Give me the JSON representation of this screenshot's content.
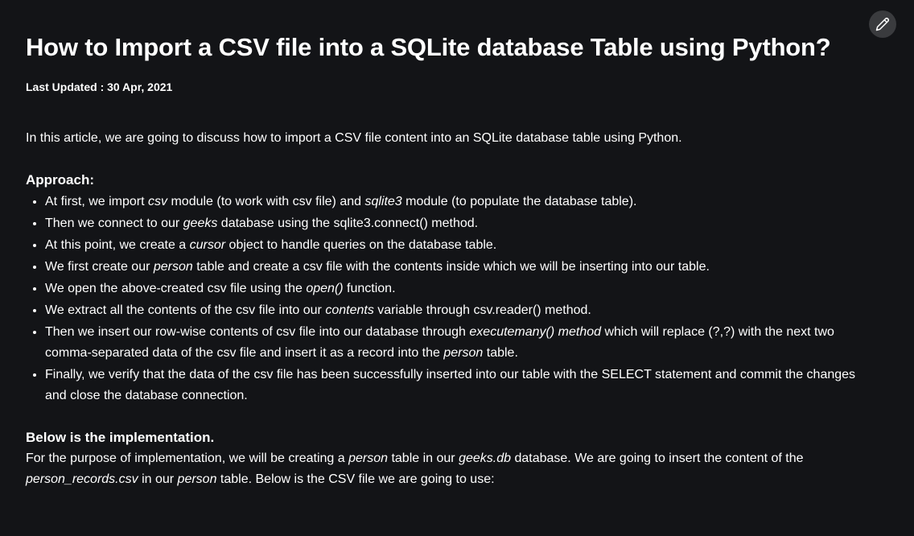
{
  "header": {
    "title": "How to Import a CSV file into a SQLite database Table using Python?",
    "last_updated": "Last Updated : 30 Apr, 2021",
    "edit_icon": "pencil-icon"
  },
  "article": {
    "intro": "In this article, we are going to discuss how to import a CSV file content into an SQLite database table using Python.",
    "approach_heading": "Approach:",
    "steps": [
      {
        "p1": "At first, we import ",
        "i1": "csv",
        "p2": " module (to work with csv file) and ",
        "i2": "sqlite3",
        "p3": " module (to populate the database table).",
        "i3": "",
        "p4": ""
      },
      {
        "p1": "Then we connect to our ",
        "i1": "geeks",
        "p2": " database using the sqlite3.connect() method.",
        "i2": "",
        "p3": "",
        "i3": "",
        "p4": ""
      },
      {
        "p1": "At this point, we create a ",
        "i1": "cursor",
        "p2": " object to handle queries on the database table.",
        "i2": "",
        "p3": "",
        "i3": "",
        "p4": ""
      },
      {
        "p1": "We first create our ",
        "i1": "person",
        "p2": " table and create a csv file with the contents inside which we will be inserting into our table.",
        "i2": "",
        "p3": "",
        "i3": "",
        "p4": ""
      },
      {
        "p1": "We open the above-created csv file using the ",
        "i1": "open()",
        "p2": " function.",
        "i2": "",
        "p3": "",
        "i3": "",
        "p4": ""
      },
      {
        "p1": "We extract all the contents of the csv file into our ",
        "i1": "contents",
        "p2": " variable through csv.reader() method.",
        "i2": "",
        "p3": "",
        "i3": "",
        "p4": ""
      },
      {
        "p1": "Then we insert our row-wise contents of csv file into our database through ",
        "i1": "executemany() method",
        "p2": " which will replace (?,?) with the next two comma-separated data of the csv file and insert it as a record into the ",
        "i2": "person",
        "p3": " table.",
        "i3": "",
        "p4": ""
      },
      {
        "p1": "Finally, we verify that the data of the csv file has been successfully inserted into our table with the SELECT statement and commit the changes and close the database connection.",
        "i1": "",
        "p2": "",
        "i2": "",
        "p3": "",
        "i3": "",
        "p4": ""
      }
    ],
    "impl_heading": "Below is the implementation.",
    "impl_para": {
      "p1": "For the purpose of implementation, we will be creating a ",
      "i1": "person",
      "p2": " table in our ",
      "i2": "geeks.db",
      "p3": " database. We are going to insert the content of the ",
      "i3": "person_records.csv",
      "p4": " in our ",
      "i4": "person",
      "p5": " table. Below is the CSV file we are going to use:"
    }
  }
}
